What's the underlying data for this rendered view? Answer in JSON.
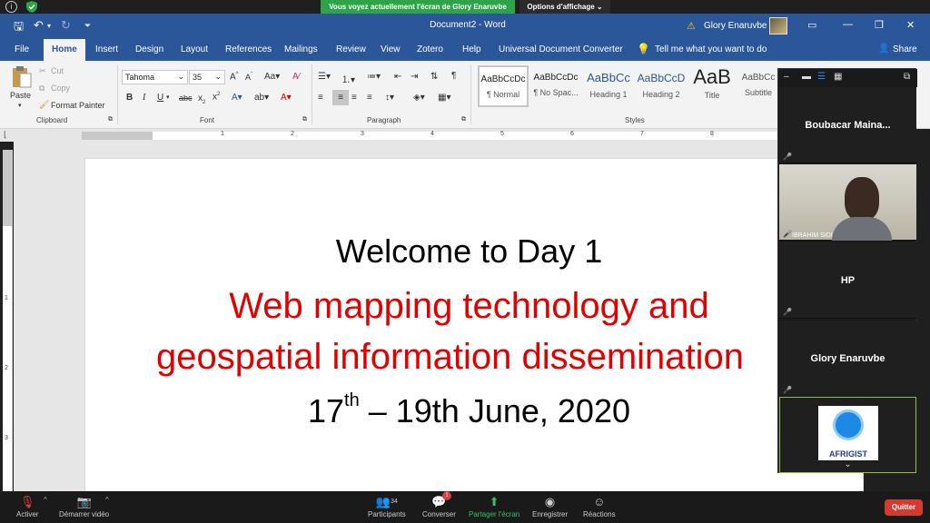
{
  "zoom": {
    "share_banner": "Vous voyez actuellement l'écran de Glory Enaruvbe",
    "view_options": "Options d'affichage ⌄"
  },
  "word": {
    "doc_title": "Document2 - Word",
    "user_name": "Glory Enaruvbe",
    "tabs": [
      "File",
      "Home",
      "Insert",
      "Design",
      "Layout",
      "References",
      "Mailings",
      "Review",
      "View",
      "Zotero",
      "Help",
      "Universal Document Converter"
    ],
    "tell_me": "Tell me what you want to do",
    "share": "Share",
    "clipboard": {
      "paste": "Paste",
      "cut": "Cut",
      "copy": "Copy",
      "format_painter": "Format Painter",
      "label": "Clipboard"
    },
    "font": {
      "name": "Tahoma",
      "size": "35",
      "label": "Font"
    },
    "paragraph_label": "Paragraph",
    "styles": [
      {
        "sample": "AaBbCcDc",
        "name": "¶ Normal"
      },
      {
        "sample": "AaBbCcDc",
        "name": "¶ No Spac..."
      },
      {
        "sample": "AaBbCc",
        "name": "Heading 1"
      },
      {
        "sample": "AaBbCcD",
        "name": "Heading 2"
      },
      {
        "sample": "AaB",
        "name": "Title"
      },
      {
        "sample": "AaBbCc",
        "name": "Subtitle"
      }
    ],
    "styles_label": "Styles"
  },
  "document": {
    "line1": "Welcome to Day 1",
    "line2": "Web mapping technology and",
    "line3": "geospatial information dissemination",
    "line4_pre": "17",
    "line4_sup": "th",
    "line4_post": " – 19th June, 2020"
  },
  "participants": [
    {
      "name": "Boubacar  Maina..."
    },
    {
      "name": "IBRAHIM SIDI"
    },
    {
      "name": "HP"
    },
    {
      "name": "Glory Enaruvbe"
    },
    {
      "name": "AFRIGIST"
    }
  ],
  "toolbar": {
    "mute": "Activer",
    "video": "Démarrer vidéo",
    "participants": "Participants",
    "participants_count": "34",
    "chat": "Converser",
    "chat_badge": "1",
    "share": "Partager l'écran",
    "record": "Enregistrer",
    "reactions": "Réactions",
    "quit": "Quitter"
  },
  "colors": {
    "word_blue": "#2b579a",
    "red_text": "#e00000",
    "zoom_green": "#2ea44a",
    "quit_red": "#d43a30"
  }
}
